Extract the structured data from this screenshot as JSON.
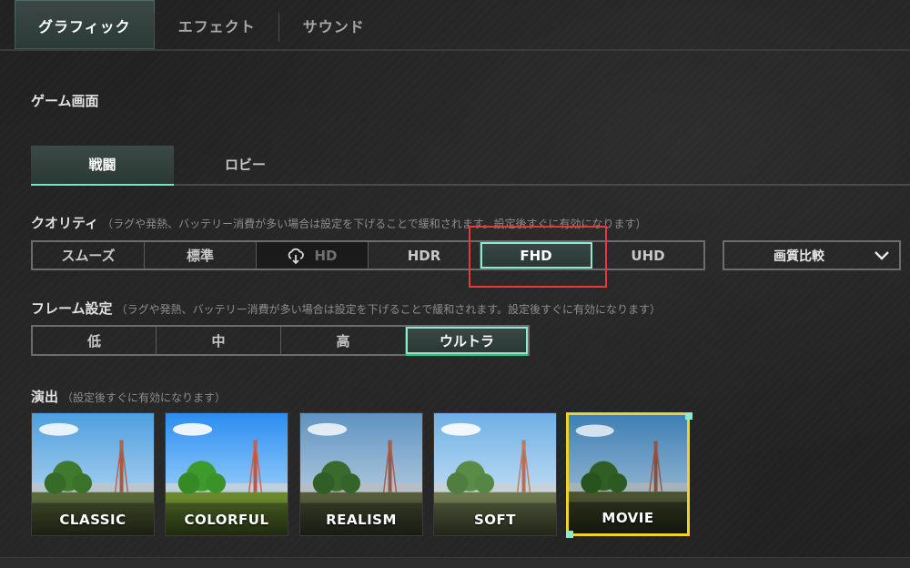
{
  "top_tabs": [
    {
      "label": "グラフィック",
      "active": true
    },
    {
      "label": "エフェクト",
      "active": false
    },
    {
      "label": "サウンド",
      "active": false
    }
  ],
  "section_title": "ゲーム画面",
  "sub_tabs": [
    {
      "label": "戦闘",
      "active": true
    },
    {
      "label": "ロビー",
      "active": false
    }
  ],
  "quality": {
    "label": "クオリティ",
    "hint": "（ラグや発熱、バッテリー消費が多い場合は設定を下げることで緩和されます。設定後すぐに有効になります）",
    "options": [
      "スムーズ",
      "標準",
      "HD",
      "HDR",
      "FHD",
      "UHD"
    ],
    "selected": "FHD",
    "disabled": [
      "HD"
    ],
    "download_icon": "cloud-download-icon",
    "compare_label": "画質比較"
  },
  "frame": {
    "label": "フレーム設定",
    "hint": "（ラグや発熱、バッテリー消費が多い場合は設定を下げることで緩和されます。設定後すぐに有効になります）",
    "options": [
      "低",
      "中",
      "高",
      "ウルトラ"
    ],
    "selected": "ウルトラ"
  },
  "style": {
    "label": "演出",
    "hint": "（設定後すぐに有効になります）",
    "options": [
      "CLASSIC",
      "COLORFUL",
      "REALISM",
      "SOFT",
      "MOVIE"
    ],
    "selected": "MOVIE"
  },
  "colors": {
    "accent": "#7fe0c9",
    "selected_border": "#f2d22a",
    "highlight_box": "#e23b3b"
  }
}
